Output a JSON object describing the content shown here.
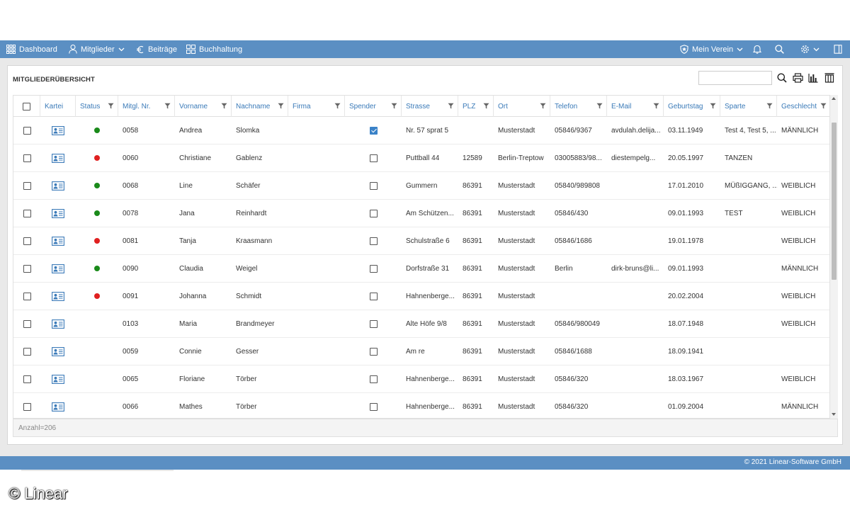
{
  "nav": {
    "dashboard": "Dashboard",
    "mitglieder": "Mitglieder",
    "beitraege": "Beiträge",
    "buchhaltung": "Buchhaltung",
    "mein_verein": "Mein Verein"
  },
  "card": {
    "title": "MITGLIEDERÜBERSICHT",
    "search_value": ""
  },
  "columns": [
    "Kartei",
    "Status",
    "Mitgl. Nr.",
    "Vorname",
    "Nachname",
    "Firma",
    "Spender",
    "Strasse",
    "PLZ",
    "Ort",
    "Telefon",
    "E-Mail",
    "Geburtstag",
    "Sparte",
    "Geschlecht"
  ],
  "rows": [
    {
      "status": "green",
      "nr": "0058",
      "vorname": "Andrea",
      "nachname": "Slomka",
      "firma": "",
      "spender": true,
      "strasse": "Nr. 57 sprat 5",
      "plz": "",
      "ort": "Musterstadt",
      "telefon": "05846/9367",
      "email": "avdulah.delija...",
      "geburtstag": "03.11.1949",
      "sparte": "Test 4, Test 5, ...",
      "geschlecht": "MÄNNLICH"
    },
    {
      "status": "red",
      "nr": "0060",
      "vorname": "Christiane",
      "nachname": "Gablenz",
      "firma": "",
      "spender": false,
      "strasse": "Puttball 44",
      "plz": "12589",
      "ort": "Berlin-Treptow",
      "telefon": "03005883/98...",
      "email": "diestempelg...",
      "geburtstag": "20.05.1997",
      "sparte": "TANZEN",
      "geschlecht": ""
    },
    {
      "status": "green",
      "nr": "0068",
      "vorname": "Line",
      "nachname": "Schäfer",
      "firma": "",
      "spender": false,
      "strasse": "Gummern",
      "plz": "86391",
      "ort": "Musterstadt",
      "telefon": "05840/989808",
      "email": "",
      "geburtstag": "17.01.2010",
      "sparte": "MÜßIGGANG, ...",
      "geschlecht": "WEIBLICH"
    },
    {
      "status": "green",
      "nr": "0078",
      "vorname": "Jana",
      "nachname": "Reinhardt",
      "firma": "",
      "spender": false,
      "strasse": "Am Schützen...",
      "plz": "86391",
      "ort": "Musterstadt",
      "telefon": "05846/430",
      "email": "",
      "geburtstag": "09.01.1993",
      "sparte": "TEST",
      "geschlecht": "WEIBLICH"
    },
    {
      "status": "red",
      "nr": "0081",
      "vorname": "Tanja",
      "nachname": "Kraasmann",
      "firma": "",
      "spender": false,
      "strasse": "Schulstraße 6",
      "plz": "86391",
      "ort": "Musterstadt",
      "telefon": "05846/1686",
      "email": "",
      "geburtstag": "19.01.1978",
      "sparte": "",
      "geschlecht": "WEIBLICH"
    },
    {
      "status": "green",
      "nr": "0090",
      "vorname": "Claudia",
      "nachname": "Weigel",
      "firma": "",
      "spender": false,
      "strasse": "Dorfstraße 31",
      "plz": "86391",
      "ort": "Musterstadt",
      "telefon": "Berlin",
      "email": "dirk-bruns@li...",
      "geburtstag": "09.01.1993",
      "sparte": "",
      "geschlecht": "MÄNNLICH"
    },
    {
      "status": "red",
      "nr": "0091",
      "vorname": "Johanna",
      "nachname": "Schmidt",
      "firma": "",
      "spender": false,
      "strasse": "Hahnenberge...",
      "plz": "86391",
      "ort": "Musterstadt",
      "telefon": "",
      "email": "",
      "geburtstag": "20.02.2004",
      "sparte": "",
      "geschlecht": "WEIBLICH"
    },
    {
      "status": "",
      "nr": "0103",
      "vorname": "Maria",
      "nachname": "Brandmeyer",
      "firma": "",
      "spender": false,
      "strasse": "Alte Höfe 9/8",
      "plz": "86391",
      "ort": "Musterstadt",
      "telefon": "05846/980049",
      "email": "",
      "geburtstag": "18.07.1948",
      "sparte": "",
      "geschlecht": "WEIBLICH"
    },
    {
      "status": "",
      "nr": "0059",
      "vorname": "Connie",
      "nachname": "Gesser",
      "firma": "",
      "spender": false,
      "strasse": "Am re",
      "plz": "86391",
      "ort": "Musterstadt",
      "telefon": "05846/1688",
      "email": "",
      "geburtstag": "18.09.1941",
      "sparte": "",
      "geschlecht": ""
    },
    {
      "status": "",
      "nr": "0065",
      "vorname": "Floriane",
      "nachname": "Törber",
      "firma": "",
      "spender": false,
      "strasse": "Hahnenberge...",
      "plz": "86391",
      "ort": "Musterstadt",
      "telefon": "05846/320",
      "email": "",
      "geburtstag": "18.03.1967",
      "sparte": "",
      "geschlecht": "WEIBLICH"
    },
    {
      "status": "",
      "nr": "0066",
      "vorname": "Mathes",
      "nachname": "Törber",
      "firma": "",
      "spender": false,
      "strasse": "Hahnenberge...",
      "plz": "86391",
      "ort": "Musterstadt",
      "telefon": "05846/320",
      "email": "",
      "geburtstag": "01.09.2004",
      "sparte": "",
      "geschlecht": "MÄNNLICH"
    }
  ],
  "status_text": "Anzahl=206",
  "footer": "© 2021 Linear-Software GmbH",
  "watermark": "© Linear",
  "colors": {
    "topbar": "#5b8fc3",
    "header_text": "#3a7ab8",
    "status_active": "#1a8a1a",
    "status_inactive": "#e02020",
    "checkbox_checked": "#3a82c8"
  },
  "icons": [
    "dashboard-grid-icon",
    "user-icon",
    "euro-icon",
    "buchhaltung-grid-icon",
    "shield-icon",
    "bell-icon",
    "search-icon",
    "gear-icon",
    "panel-icon",
    "print-icon",
    "bar-chart-icon",
    "columns-icon",
    "filter-icon",
    "contact-card-icon"
  ]
}
